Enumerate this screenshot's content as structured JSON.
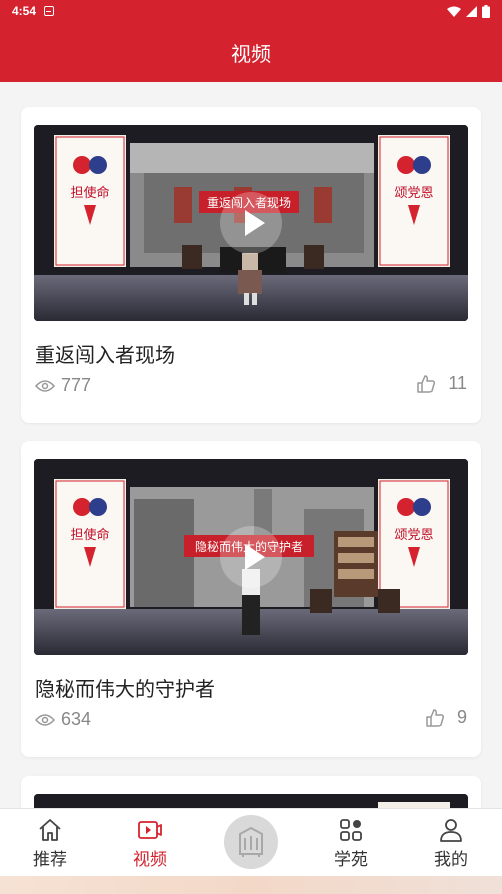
{
  "status_bar": {
    "time": "4:54"
  },
  "app_bar": {
    "title": "视频"
  },
  "videos": [
    {
      "title": "重返闯入者现场",
      "views": "777",
      "likes": "11",
      "banner": "重返闯入者现场",
      "side_left": "担使命",
      "side_right": "颂党恩"
    },
    {
      "title": "隐秘而伟大的守护者",
      "views": "634",
      "likes": "9",
      "banner": "隐秘而伟大的守护者",
      "side_left": "担使命",
      "side_right": "颂党恩"
    }
  ],
  "bottom_nav": {
    "items": [
      {
        "label": "推荐",
        "icon": "home-icon",
        "active": false
      },
      {
        "label": "视频",
        "icon": "video-play-icon",
        "active": true
      },
      {
        "label": "",
        "icon": "center-logo-icon",
        "active": false
      },
      {
        "label": "学苑",
        "icon": "grid-apps-icon",
        "active": false
      },
      {
        "label": "我的",
        "icon": "user-icon",
        "active": false
      }
    ]
  },
  "colors": {
    "primary": "#d4232e",
    "background": "#f4f4f4",
    "text": "#222222",
    "muted": "#888888"
  }
}
